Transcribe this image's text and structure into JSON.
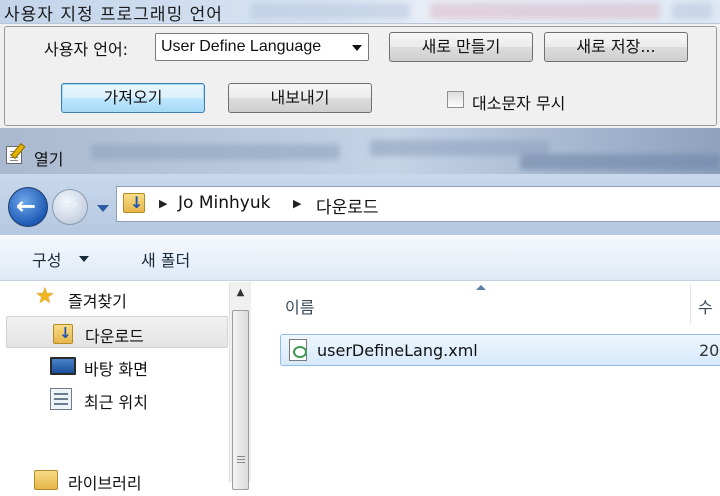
{
  "udl_dialog": {
    "title": "사용자 지정 프로그래밍 언어",
    "language_label": "사용자 언어:",
    "language_value": "User Define Language",
    "new_button": "새로 만들기",
    "save_as_button": "새로 저장...",
    "import_button": "가져오기",
    "export_button": "내보내기",
    "ignore_case_label": "대소문자 무시",
    "ignore_case_checked": false
  },
  "open_dialog": {
    "title": "열기",
    "breadcrumb": [
      "Jo Minhyuk",
      "다운로드"
    ],
    "toolbar": {
      "organize": "구성",
      "new_folder": "새 폴더"
    },
    "nav_items": [
      {
        "label": "즐겨찾기",
        "icon": "star-icon"
      },
      {
        "label": "다운로드",
        "icon": "downloads-folder-icon",
        "selected": true
      },
      {
        "label": "바탕 화면",
        "icon": "desktop-icon"
      },
      {
        "label": "최근 위치",
        "icon": "recent-places-icon"
      },
      {
        "label": "라이브러리",
        "icon": "library-icon"
      }
    ],
    "columns": {
      "name": "이름",
      "modified": "수"
    },
    "files": [
      {
        "name": "userDefineLang.xml",
        "date": "20",
        "icon": "xml-file-icon"
      }
    ]
  }
}
